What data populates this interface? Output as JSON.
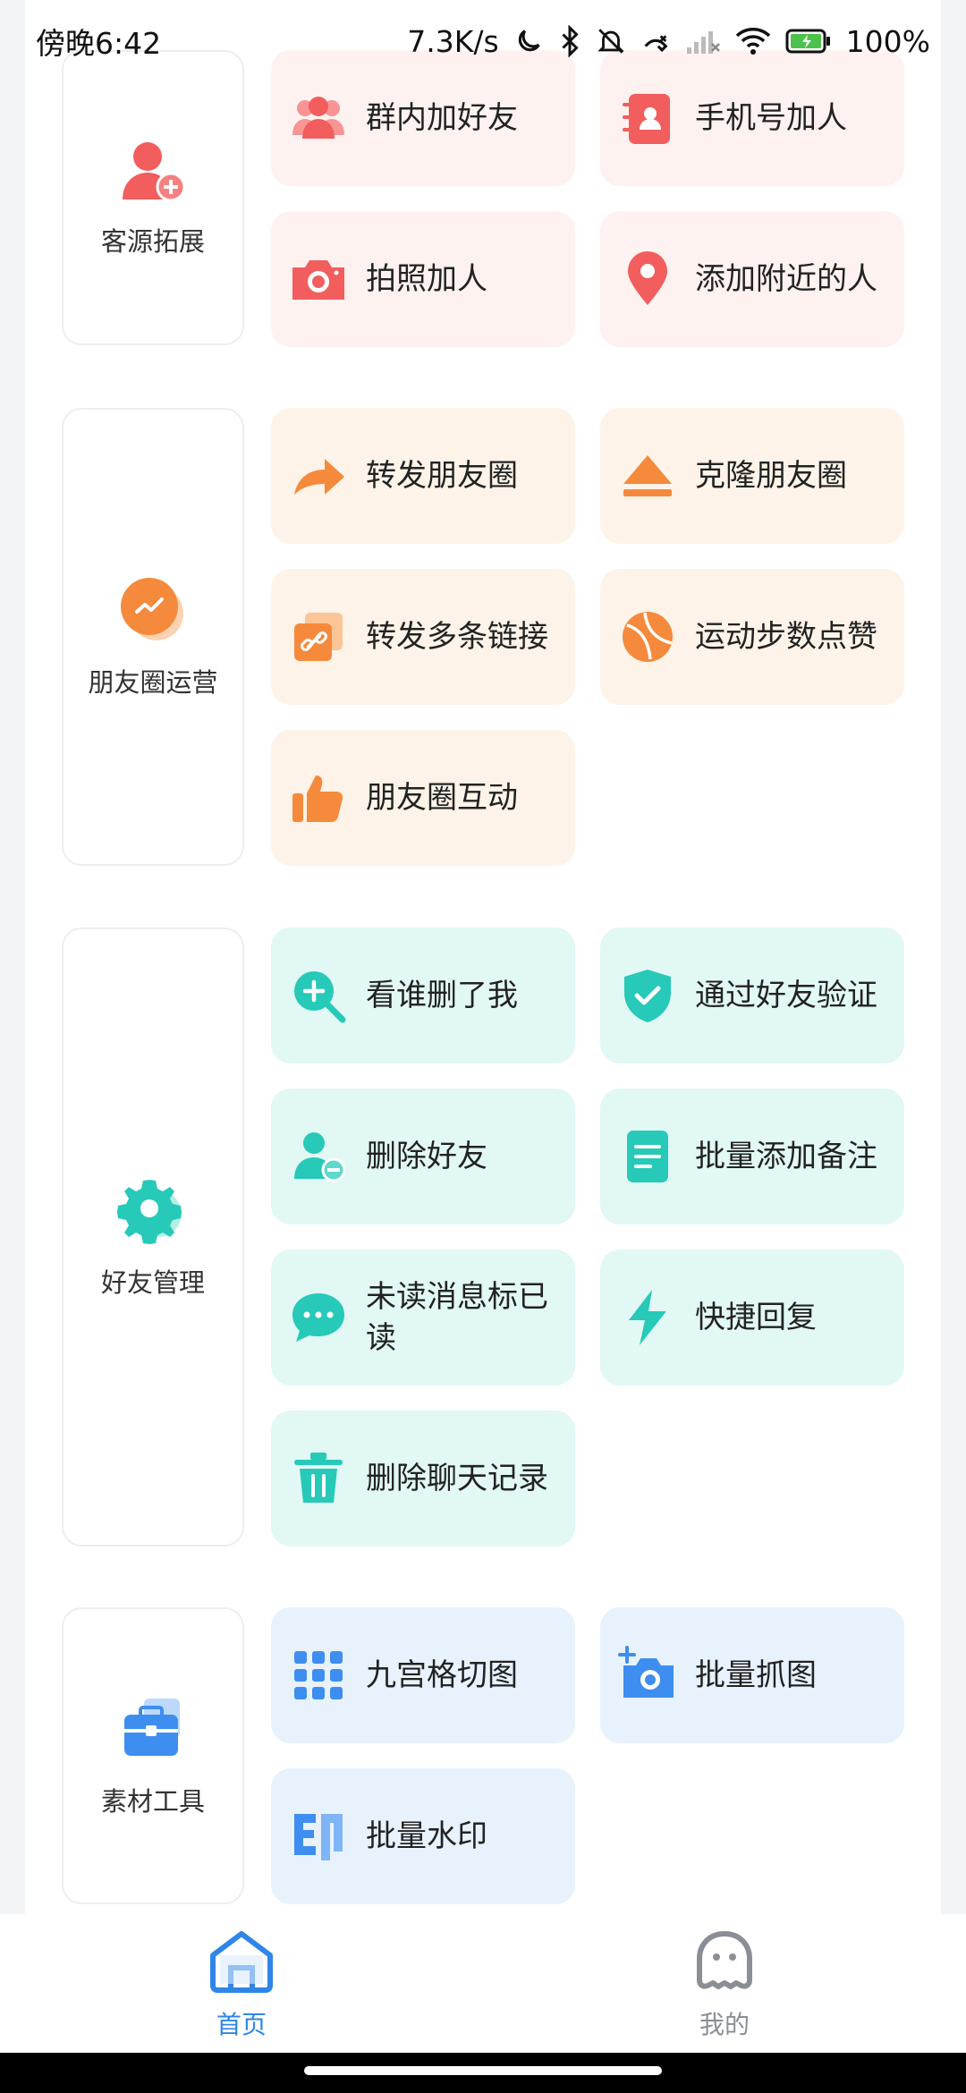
{
  "status_bar": {
    "time": "傍晚6:42",
    "speed": "7.3K/s",
    "battery": "100%"
  },
  "sections": [
    {
      "category": "客源拓展",
      "theme": "#f25d5d",
      "tiles": [
        "群内加好友",
        "手机号加人",
        "拍照加人",
        "添加附近的人"
      ]
    },
    {
      "category": "朋友圈运营",
      "theme": "#f58a3c",
      "tiles": [
        "转发朋友圈",
        "克隆朋友圈",
        "转发多条链接",
        "运动步数点赞",
        "朋友圈互动"
      ]
    },
    {
      "category": "好友管理",
      "theme": "#27c9b8",
      "tiles": [
        "看谁删了我",
        "通过好友验证",
        "删除好友",
        "批量添加备注",
        "未读消息标已读",
        "快捷回复",
        "删除聊天记录"
      ]
    },
    {
      "category": "素材工具",
      "theme": "#3d8ef0",
      "tiles": [
        "九宫格切图",
        "批量抓图",
        "批量水印"
      ]
    }
  ],
  "bottom_nav": {
    "home_label": "首页",
    "mine_label": "我的",
    "active_color": "#2f86e8",
    "inactive_color": "#8a8f96"
  }
}
